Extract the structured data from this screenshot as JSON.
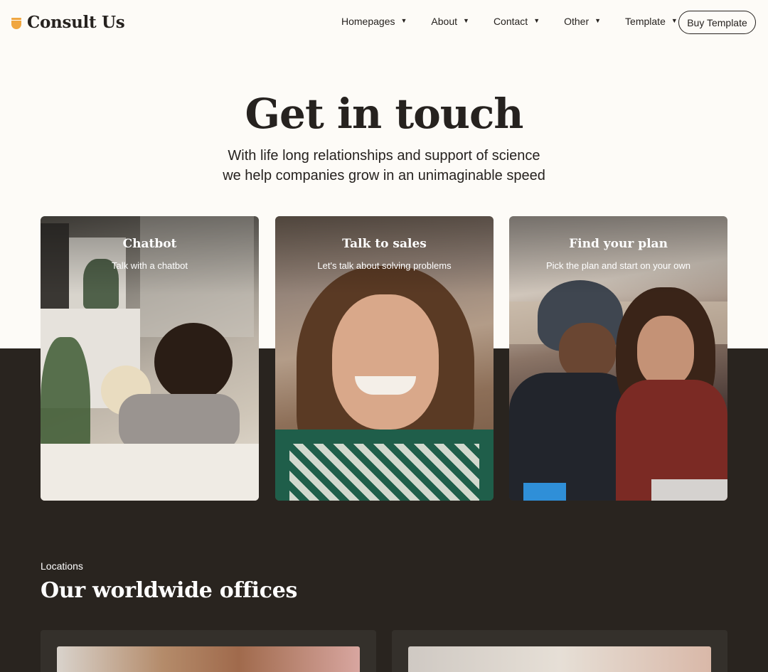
{
  "header": {
    "logo_text": "Consult Us",
    "nav": [
      {
        "label": "Homepages"
      },
      {
        "label": "About"
      },
      {
        "label": "Contact"
      },
      {
        "label": "Other"
      },
      {
        "label": "Template"
      }
    ],
    "buy_button": "Buy Template"
  },
  "hero": {
    "title": "Get in touch",
    "subtitle_line1": "With life long relationships and support of science",
    "subtitle_line2": "we help companies grow in an unimaginable speed"
  },
  "cards": [
    {
      "title": "Chatbot",
      "description": "Talk with a chatbot"
    },
    {
      "title": "Talk to sales",
      "description": "Let's talk about solving problems"
    },
    {
      "title": "Find your plan",
      "description": "Pick the plan and start on your own"
    }
  ],
  "locations": {
    "label": "Locations",
    "title": "Our worldwide offices"
  },
  "colors": {
    "accent": "#f0a640",
    "page_bg": "#fdfbf7",
    "dark_bg": "#29241f",
    "text": "#26221f"
  },
  "icons": {
    "nav_chevron": "chevron-down-icon",
    "logo": "logo-mark-icon"
  }
}
